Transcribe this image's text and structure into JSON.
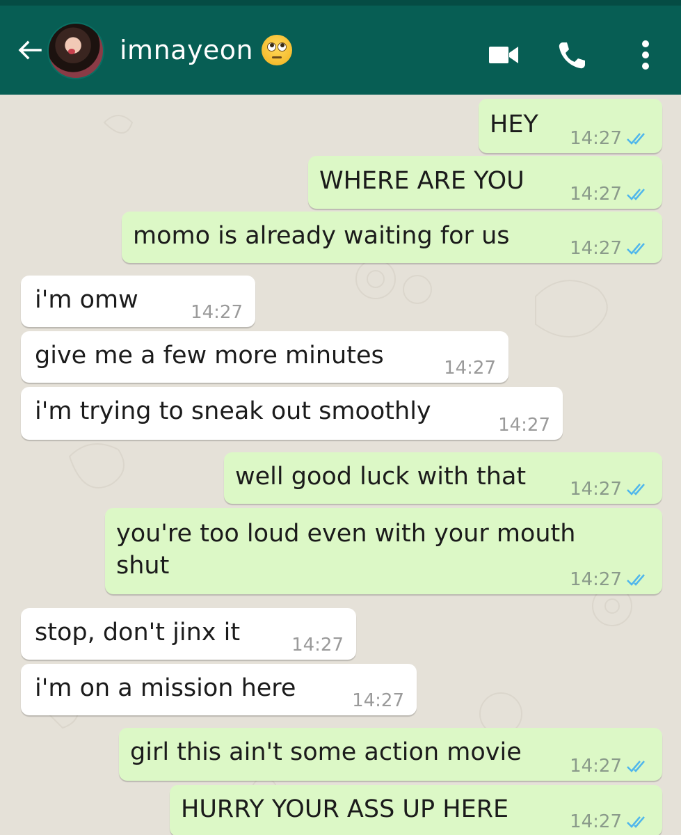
{
  "header": {
    "contact_name": "imnayeon",
    "icons": [
      "back-arrow-icon",
      "avatar",
      "eye-roll-emoji-icon",
      "video-call-icon",
      "phone-icon",
      "more-options-icon"
    ]
  },
  "messages": [
    {
      "dir": "out",
      "text": "HEY",
      "time": "14:27",
      "status": "read"
    },
    {
      "dir": "out",
      "text": "WHERE ARE YOU",
      "time": "14:27",
      "status": "read"
    },
    {
      "dir": "out",
      "text": "momo is already waiting for us",
      "time": "14:27",
      "status": "read"
    },
    {
      "dir": "in",
      "text": "i'm omw",
      "time": "14:27"
    },
    {
      "dir": "in",
      "text": "give me a few more minutes",
      "time": "14:27"
    },
    {
      "dir": "in",
      "text": "i'm trying to sneak out smoothly",
      "time": "14:27"
    },
    {
      "dir": "out",
      "text": "well good luck with that",
      "time": "14:27",
      "status": "read"
    },
    {
      "dir": "out",
      "text_line1": "you're too loud even with your mouth",
      "text_line2": "shut",
      "time": "14:27",
      "status": "read"
    },
    {
      "dir": "in",
      "text": "stop, don't jinx it",
      "time": "14:27"
    },
    {
      "dir": "in",
      "text": "i'm on a mission here",
      "time": "14:27"
    },
    {
      "dir": "out",
      "text": "girl this ain't some action movie",
      "time": "14:27",
      "status": "read"
    },
    {
      "dir": "out",
      "text": "HURRY YOUR ASS UP HERE",
      "time": "14:27",
      "status": "read"
    }
  ],
  "colors": {
    "header": "#075e54",
    "outgoing_bubble": "#dcf8c6",
    "incoming_bubble": "#ffffff",
    "read_ticks": "#4fb6ec",
    "background": "#e5e1d8"
  }
}
